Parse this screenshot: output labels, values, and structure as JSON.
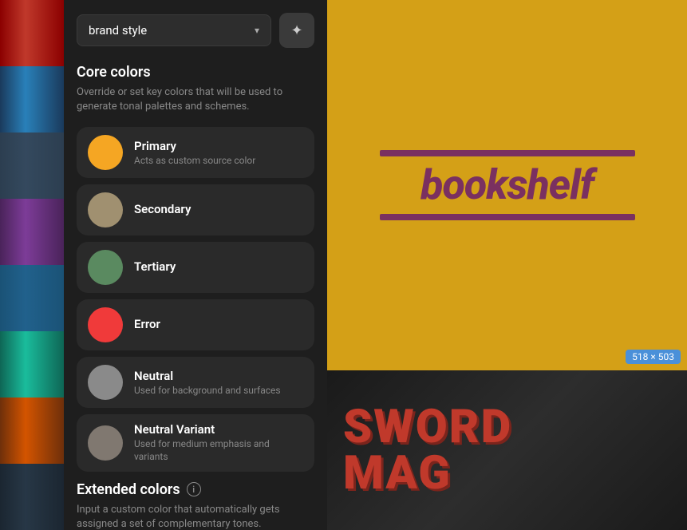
{
  "bookStrip": {
    "spines": [
      {
        "id": "spine-1",
        "class": "book-spine-1"
      },
      {
        "id": "spine-2",
        "class": "book-spine-2"
      },
      {
        "id": "spine-3",
        "class": "book-spine-3"
      },
      {
        "id": "spine-4",
        "class": "book-spine-4"
      },
      {
        "id": "spine-5",
        "class": "book-spine-5"
      },
      {
        "id": "spine-6",
        "class": "book-spine-6"
      },
      {
        "id": "spine-7",
        "class": "book-spine-7"
      },
      {
        "id": "spine-8",
        "class": "book-spine-8"
      }
    ]
  },
  "panel": {
    "brandStyleSelect": {
      "label": "brand style",
      "chevron": "▾"
    },
    "magicButton": {
      "icon": "✦"
    },
    "coreColors": {
      "title": "Core colors",
      "description": "Override or set key colors that will be used to generate tonal palettes and schemes.",
      "items": [
        {
          "id": "primary",
          "name": "Primary",
          "description": "Acts as custom source color",
          "color": "#f5a623"
        },
        {
          "id": "secondary",
          "name": "Secondary",
          "description": "",
          "color": "#a09070"
        },
        {
          "id": "tertiary",
          "name": "Tertiary",
          "description": "",
          "color": "#5a8a60"
        },
        {
          "id": "error",
          "name": "Error",
          "description": "",
          "color": "#f03a3a"
        },
        {
          "id": "neutral",
          "name": "Neutral",
          "description": "Used for background and surfaces",
          "color": "#8a8a8a"
        },
        {
          "id": "neutral-variant",
          "name": "Neutral Variant",
          "description": "Used for medium emphasis and variants",
          "color": "#807870"
        }
      ]
    },
    "extendedColors": {
      "title": "Extended colors",
      "description": "Input a custom color that automatically gets assigned a set of complementary tones."
    }
  },
  "preview": {
    "top": {
      "logoText": "bookshelf",
      "backgroundColor": "#d4a017",
      "textColor": "#7a3060",
      "sizeBadge": "518 × 503"
    },
    "bottom": {
      "text": "SWORD MAGE"
    }
  }
}
